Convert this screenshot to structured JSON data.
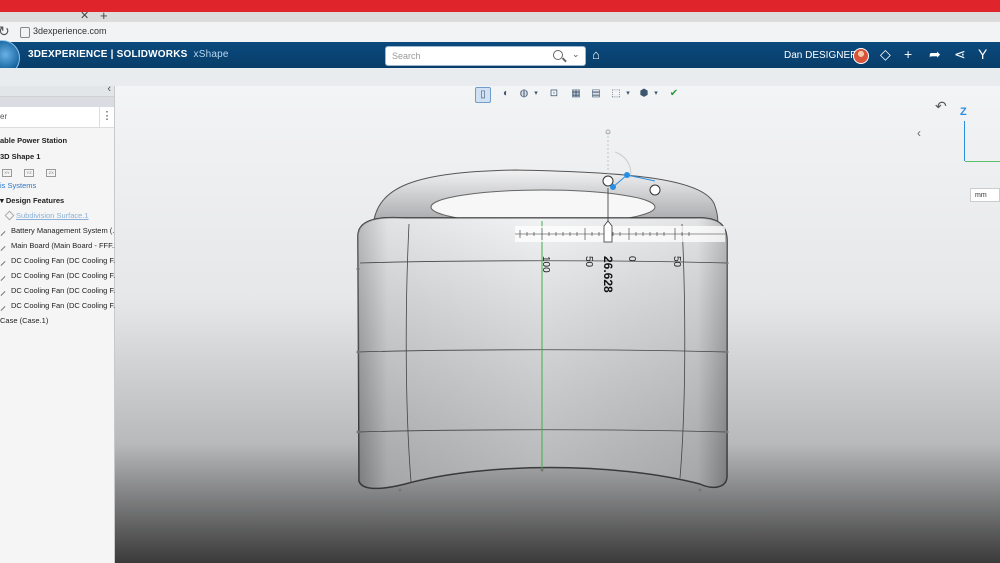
{
  "browser": {
    "url": "3dexperience.com"
  },
  "app": {
    "brand_bold": "3DEXPERIENCE | SOLIDWORKS",
    "brand_app": "xShape",
    "search_placeholder": "Search",
    "user_name": "Dan DESIGNER"
  },
  "tree": {
    "filter_text": "er",
    "items": [
      {
        "label": "able Power Station",
        "style": "bold"
      },
      {
        "label": "3D Shape 1",
        "style": "normal"
      },
      {
        "label": "is Systems",
        "style": "blue"
      },
      {
        "label": "Design Features",
        "style": "normal"
      },
      {
        "label": "Subdivision Surface.1",
        "style": "underline"
      },
      {
        "label": "Battery Management System (...",
        "style": "normal"
      },
      {
        "label": "Main Board (Main Board - FFF.1)",
        "style": "normal"
      },
      {
        "label": "DC Cooling Fan (DC Cooling F...",
        "style": "normal"
      },
      {
        "label": "DC Cooling Fan (DC Cooling F...",
        "style": "normal"
      },
      {
        "label": "DC Cooling Fan (DC Cooling F...",
        "style": "normal"
      },
      {
        "label": "DC Cooling Fan (DC Cooling F...",
        "style": "normal"
      },
      {
        "label": "Case (Case.1)",
        "style": "normal"
      }
    ],
    "plane_labels": [
      "XY",
      "YZ",
      "ZX"
    ]
  },
  "viewport": {
    "unit": "mm",
    "axis_label": "Z",
    "dimension_value": "26.628",
    "scale_labels": [
      "100",
      "50",
      "0",
      "50"
    ]
  }
}
